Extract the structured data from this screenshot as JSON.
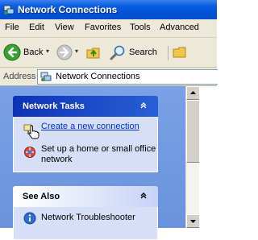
{
  "window": {
    "title": "Network Connections"
  },
  "menu": {
    "items": [
      "File",
      "Edit",
      "View",
      "Favorites",
      "Tools",
      "Advanced"
    ]
  },
  "toolbar": {
    "back_label": "Back",
    "search_label": "Search"
  },
  "address": {
    "label": "Address",
    "value": "Network Connections"
  },
  "network_tasks": {
    "title": "Network Tasks",
    "items": [
      "Create a new connection",
      "Set up a home or small office network"
    ]
  },
  "see_also": {
    "title": "See Also",
    "items": [
      "Network Troubleshooter"
    ]
  },
  "colors": {
    "title_bar": "#0052d6",
    "task_pane": "#7aa1e6",
    "link": "#0033cc"
  },
  "icons": [
    "network-connections-icon",
    "back-arrow-icon",
    "forward-arrow-icon",
    "up-folder-icon",
    "search-icon",
    "folders-icon",
    "chevron-up-icon",
    "new-connection-icon",
    "home-network-icon",
    "info-icon",
    "hand-cursor-icon"
  ]
}
